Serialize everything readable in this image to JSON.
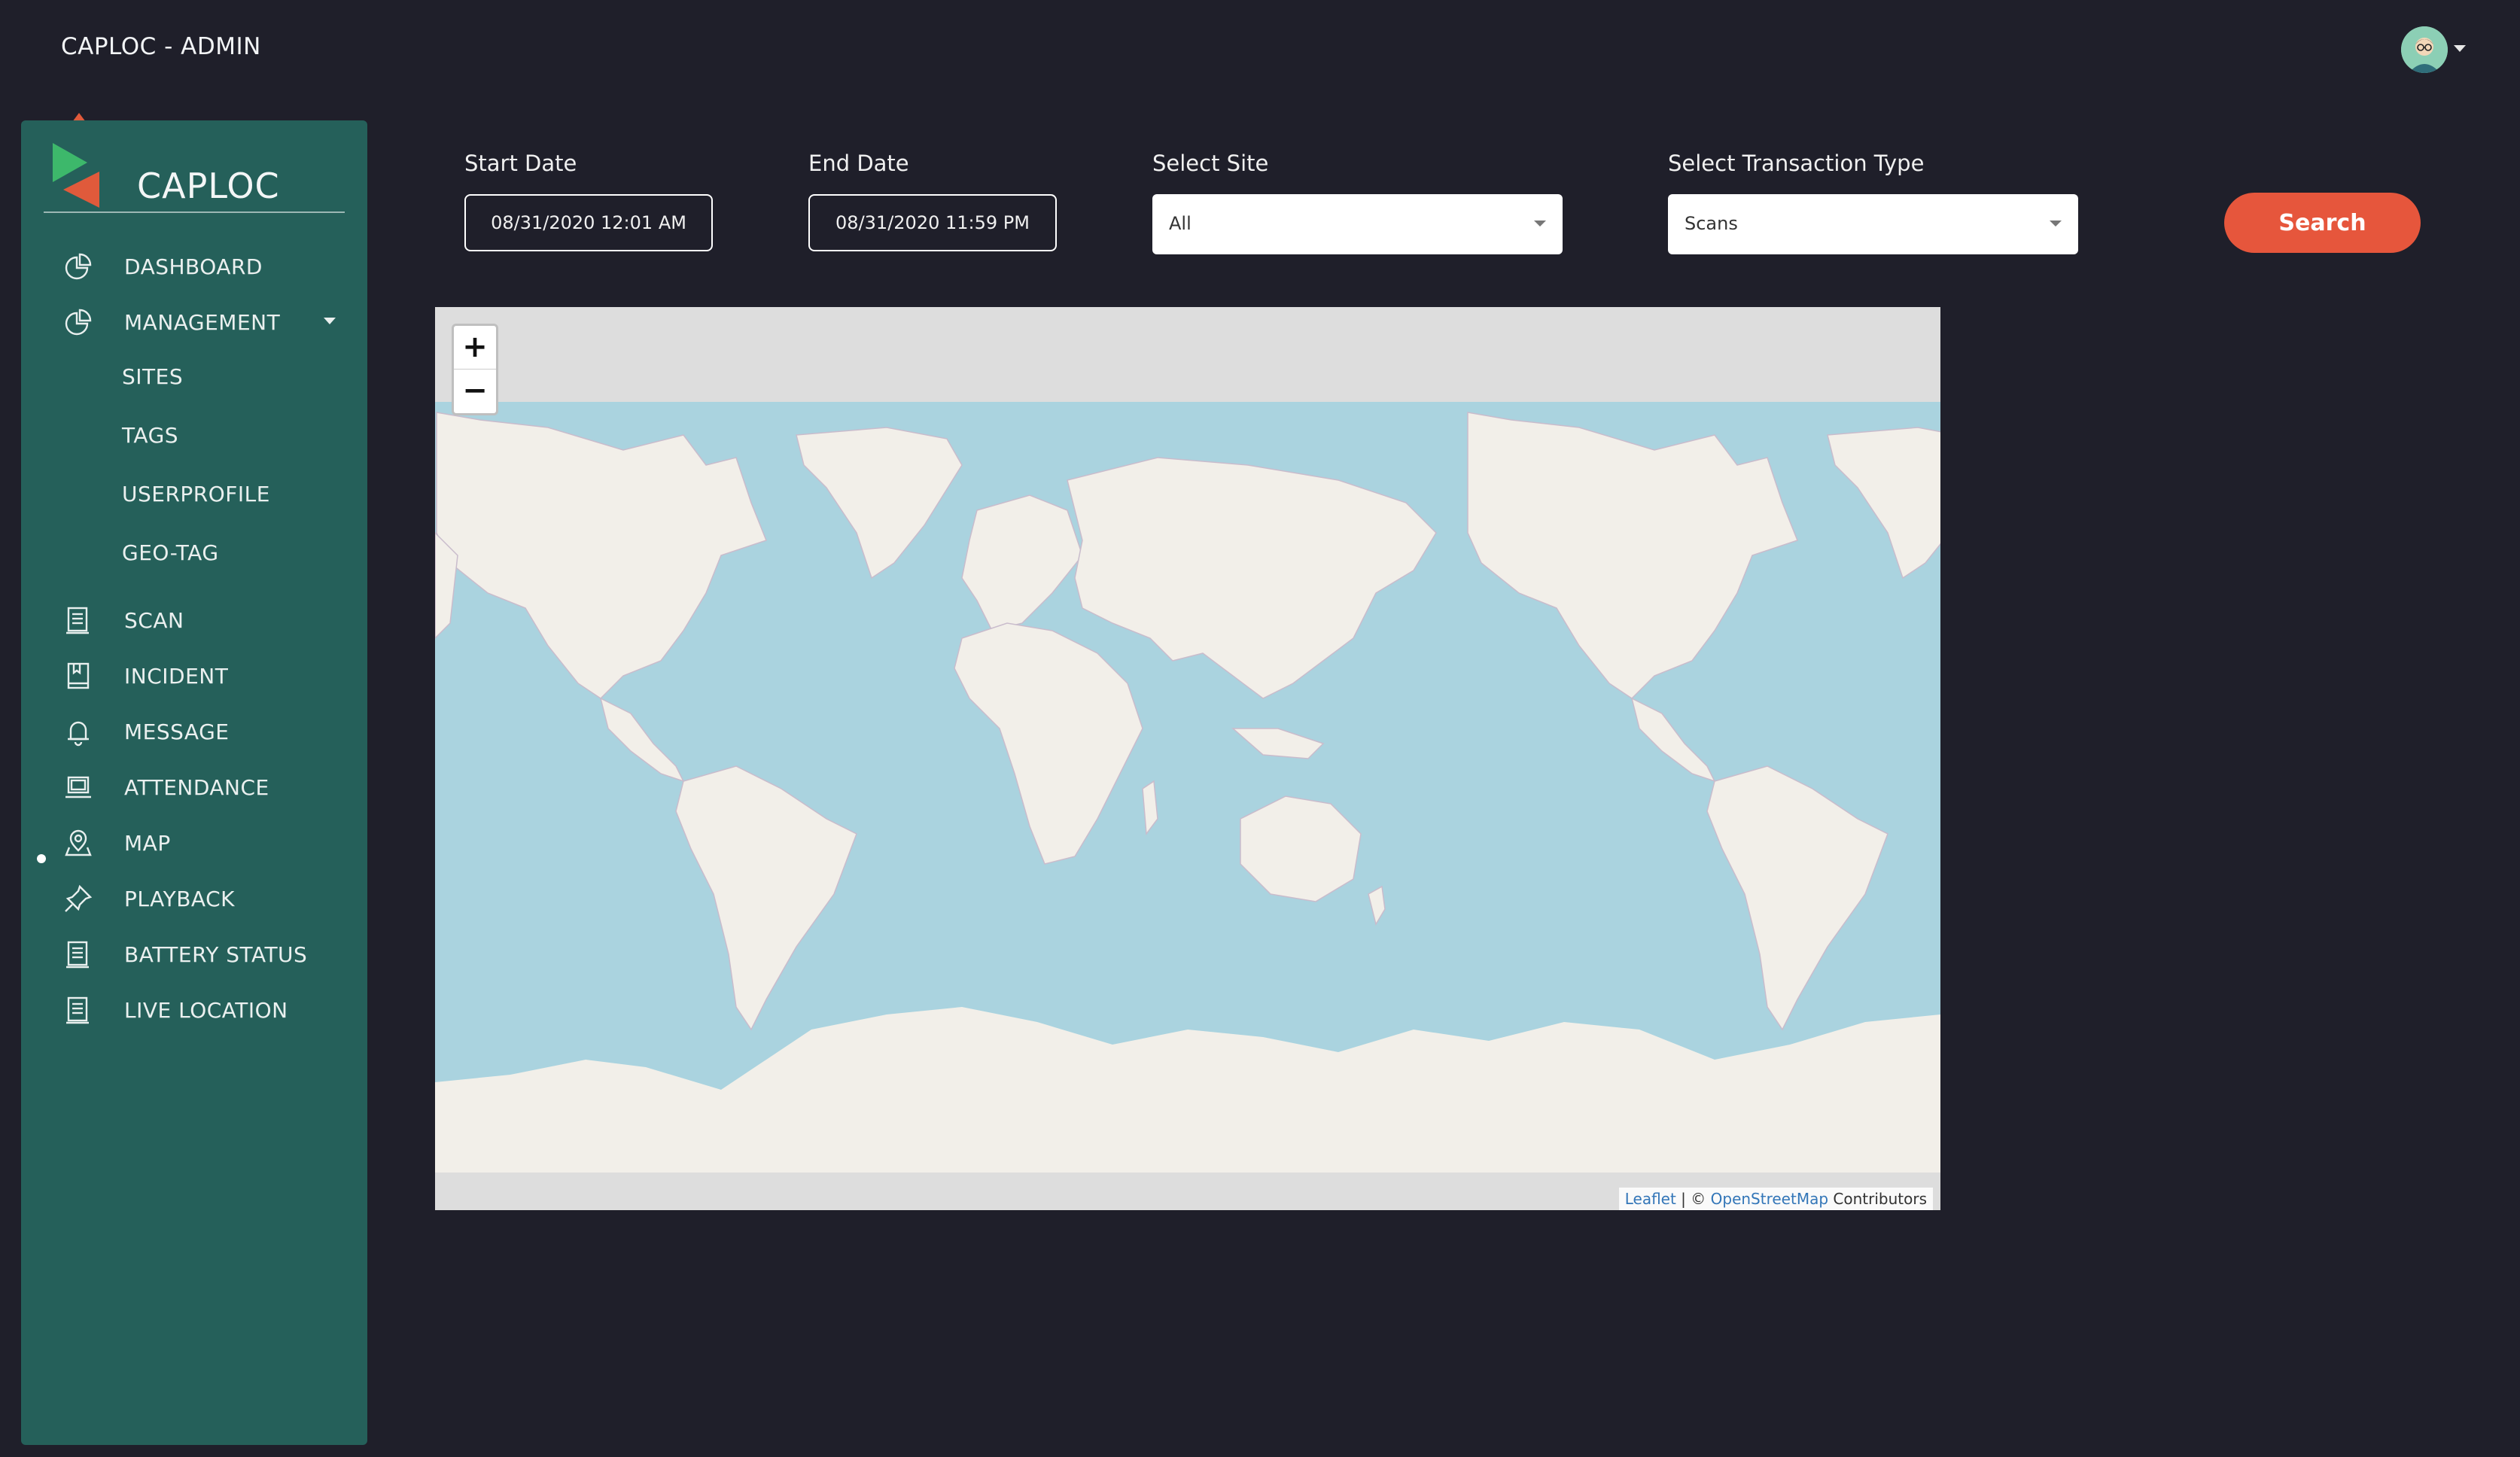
{
  "app": {
    "title": "CAPLOC - ADMIN"
  },
  "user": {
    "avatar_icon": "user-avatar-icon"
  },
  "sidebar": {
    "brand": "CAPLOC",
    "items": [
      {
        "label": "DASHBOARD",
        "icon": "pie-chart-icon"
      },
      {
        "label": "MANAGEMENT",
        "icon": "pie-chart-icon"
      },
      {
        "label": "SCAN",
        "icon": "document-icon"
      },
      {
        "label": "INCIDENT",
        "icon": "book-icon"
      },
      {
        "label": "MESSAGE",
        "icon": "bell-icon"
      },
      {
        "label": "ATTENDANCE",
        "icon": "laptop-icon"
      },
      {
        "label": "MAP",
        "icon": "map-pin-icon"
      },
      {
        "label": "PLAYBACK",
        "icon": "pin-icon"
      },
      {
        "label": "BATTERY STATUS",
        "icon": "document-icon"
      },
      {
        "label": "LIVE LOCATION",
        "icon": "document-icon"
      }
    ],
    "sub_items": [
      {
        "label": "SITES"
      },
      {
        "label": "TAGS"
      },
      {
        "label": "USERPROFILE"
      },
      {
        "label": "GEO-TAG"
      }
    ],
    "active": "MAP"
  },
  "filters": {
    "start_date_label": "Start Date",
    "start_date_value": "08/31/2020 12:01 AM",
    "end_date_label": "End Date",
    "end_date_value": "08/31/2020 11:59 PM",
    "site_label": "Select Site",
    "site_value": "All",
    "txn_label": "Select Transaction Type",
    "txn_value": "Scans",
    "search_label": "Search"
  },
  "map": {
    "zoom_in": "+",
    "zoom_out": "−",
    "attribution_leaflet": "Leaflet",
    "attribution_sep": " | © ",
    "attribution_osm": "OpenStreetMap",
    "attribution_tail": " Contributors",
    "colors": {
      "water": "#aad3df",
      "land": "#f2efe9",
      "border": "#c9bccc"
    }
  },
  "colors": {
    "background": "#1f1f2a",
    "sidebar": "#25605a",
    "accent": "#e6563c"
  }
}
